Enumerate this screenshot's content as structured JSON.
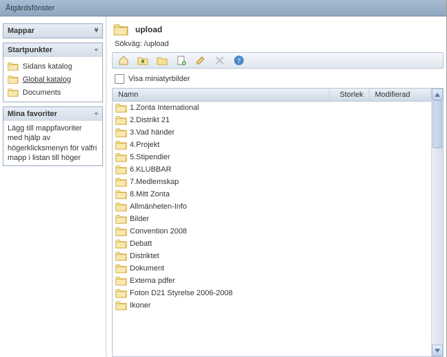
{
  "window": {
    "title": "Åtgärdsfönster"
  },
  "sidebar": {
    "panels": {
      "folders": {
        "title": "Mappar"
      },
      "startpoints": {
        "title": "Startpunkter",
        "items": [
          {
            "label": "Sidans katalog",
            "underline": false
          },
          {
            "label": "Global katalog",
            "underline": true
          },
          {
            "label": "Documents",
            "underline": false
          }
        ]
      },
      "favorites": {
        "title": "Mina favoriter",
        "help": "Lägg till mappfavoriter med hjälp av högerklicksmenyn för valfri mapp i listan till höger"
      }
    }
  },
  "main": {
    "title": "upload",
    "path": "Sökväg: /upload",
    "thumbLabel": "Visa miniatyrbilder",
    "columns": {
      "name": "Namn",
      "size": "Storlek",
      "mod": "Modifierad"
    },
    "items": [
      "1.Zonta International",
      "2.Distrikt 21",
      "3.Vad händer",
      "4.Projekt",
      "5.Stipendier",
      "6.KLUBBAR",
      "7.Medlemskap",
      "8.Mitt Zonta",
      "Allmänheten-Info",
      "Bilder",
      "Convention 2008",
      "Debatt",
      "Distriktet",
      "Dokument",
      "Externa pdfer",
      "Foton D21 Styrelse 2006-2008",
      "Ikoner"
    ]
  },
  "icons": {
    "folder": "folder-icon"
  }
}
